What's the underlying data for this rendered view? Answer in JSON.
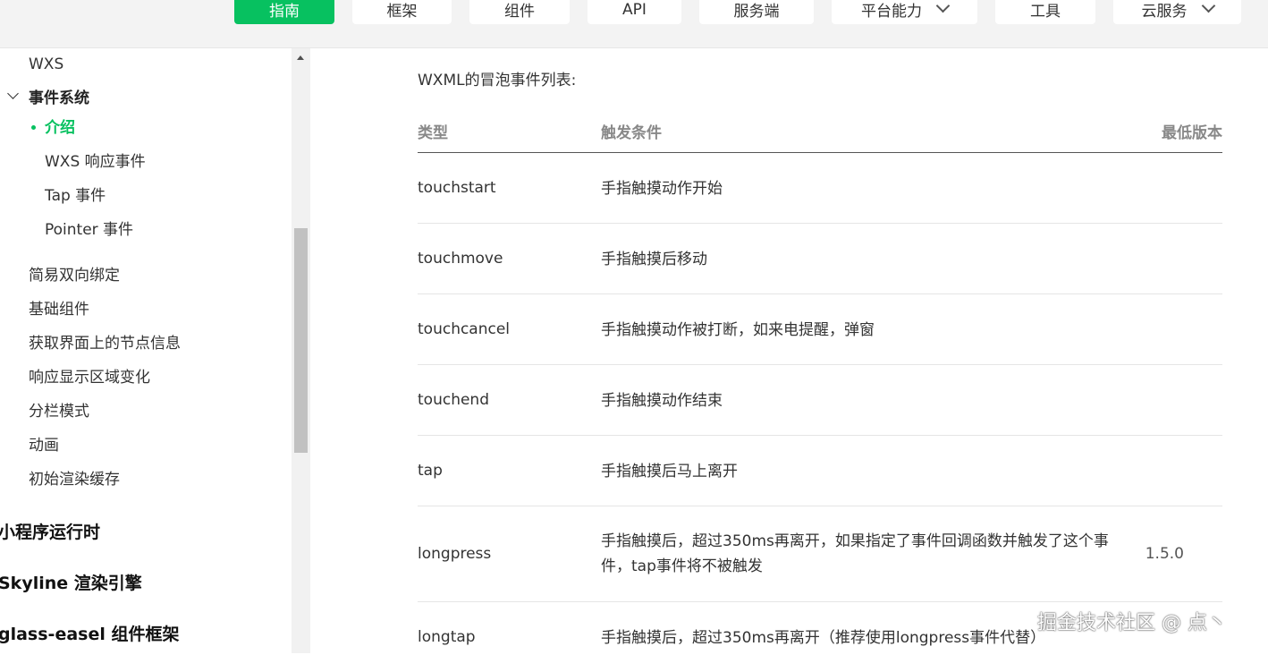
{
  "topnav": {
    "tabs": [
      {
        "label": "指南",
        "active": true
      },
      {
        "label": "框架"
      },
      {
        "label": "组件"
      },
      {
        "label": "API"
      },
      {
        "label": "服务端"
      },
      {
        "label": "平台能力",
        "dropdown": true
      },
      {
        "label": "工具"
      },
      {
        "label": "云服务",
        "dropdown": true
      }
    ]
  },
  "sidebar": {
    "wxs": "WXS",
    "event_system": "事件系统",
    "intro": "介绍",
    "wxs_response": "WXS 响应事件",
    "tap_event": "Tap 事件",
    "pointer_event": "Pointer 事件",
    "binding": "简易双向绑定",
    "basic_components": "基础组件",
    "node_info": "获取界面上的节点信息",
    "display_area": "响应显示区域变化",
    "column_mode": "分栏模式",
    "animation": "动画",
    "initial_cache": "初始渲染缓存",
    "runtime": "小程序运行时",
    "skyline": "Skyline 渲染引擎",
    "glass_easel": "glass-easel 组件框架"
  },
  "content": {
    "intro": "WXML的冒泡事件列表:",
    "headers": {
      "type": "类型",
      "condition": "触发条件",
      "version": "最低版本"
    },
    "rows": [
      {
        "type": "touchstart",
        "condition": "手指触摸动作开始",
        "version": ""
      },
      {
        "type": "touchmove",
        "condition": "手指触摸后移动",
        "version": ""
      },
      {
        "type": "touchcancel",
        "condition": "手指触摸动作被打断，如来电提醒，弹窗",
        "version": ""
      },
      {
        "type": "touchend",
        "condition": "手指触摸动作结束",
        "version": ""
      },
      {
        "type": "tap",
        "condition": "手指触摸后马上离开",
        "version": ""
      },
      {
        "type": "longpress",
        "condition": "手指触摸后，超过350ms再离开，如果指定了事件回调函数并触发了这个事件，tap事件将不被触发",
        "version": "1.5.0"
      },
      {
        "type": "longtap",
        "condition": "手指触摸后，超过350ms再离开（推荐使用longpress事件代替）",
        "version": ""
      }
    ]
  },
  "watermark": "掘金技术社区 @ 点丶",
  "colors": {
    "accent": "#07c160"
  }
}
